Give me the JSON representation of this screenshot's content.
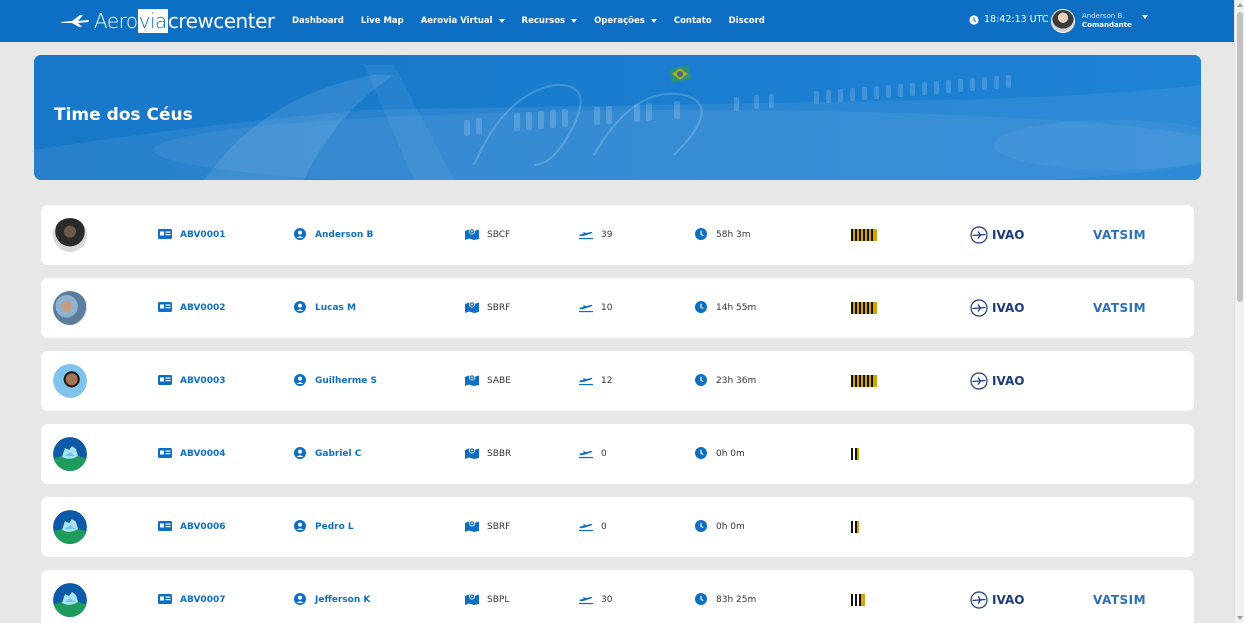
{
  "brand": {
    "part1": "Aero",
    "part2": "via",
    "part3": "crewcenter"
  },
  "nav": {
    "items": [
      {
        "label": "Dashboard",
        "dropdown": false
      },
      {
        "label": "Live Map",
        "dropdown": false
      },
      {
        "label": "Aerovia Virtual",
        "dropdown": true
      },
      {
        "label": "Recursos",
        "dropdown": true
      },
      {
        "label": "Operações",
        "dropdown": true
      },
      {
        "label": "Contato",
        "dropdown": false
      },
      {
        "label": "Discord",
        "dropdown": false
      }
    ]
  },
  "clock": "18:42:13 UTC",
  "user": {
    "name": "Anderson B.",
    "role": "Comandante"
  },
  "hero": {
    "title": "Time dos Céus"
  },
  "colors": {
    "primary": "#0d6fc4",
    "rank_gold": "#d6a400"
  },
  "pilots": [
    {
      "id": "ABV0001",
      "name": "Anderson B",
      "base": "SBCF",
      "flights": "39",
      "hours": "58h 3m",
      "rank_stripes": 4,
      "ivao": "IVAO",
      "vatsim": "VATSIM",
      "avatar": "photo-dark"
    },
    {
      "id": "ABV0002",
      "name": "Lucas M",
      "base": "SBRF",
      "flights": "10",
      "hours": "14h 55m",
      "rank_stripes": 4,
      "ivao": "IVAO",
      "vatsim": "VATSIM",
      "avatar": "photo-group"
    },
    {
      "id": "ABV0003",
      "name": "Guilherme S",
      "base": "SABE",
      "flights": "12",
      "hours": "23h 36m",
      "rank_stripes": 4,
      "ivao": "IVAO",
      "vatsim": "",
      "avatar": "photo-sky"
    },
    {
      "id": "ABV0004",
      "name": "Gabriel C",
      "base": "SBBR",
      "flights": "0",
      "hours": "0h 0m",
      "rank_stripes": 1,
      "ivao": "",
      "vatsim": "",
      "avatar": "default"
    },
    {
      "id": "ABV0006",
      "name": "Pedro L",
      "base": "SBRF",
      "flights": "0",
      "hours": "0h 0m",
      "rank_stripes": 1,
      "ivao": "",
      "vatsim": "",
      "avatar": "default"
    },
    {
      "id": "ABV0007",
      "name": "Jefferson K",
      "base": "SBPL",
      "flights": "30",
      "hours": "83h 25m",
      "rank_stripes": 2,
      "ivao": "IVAO",
      "vatsim": "VATSIM",
      "avatar": "default"
    }
  ]
}
